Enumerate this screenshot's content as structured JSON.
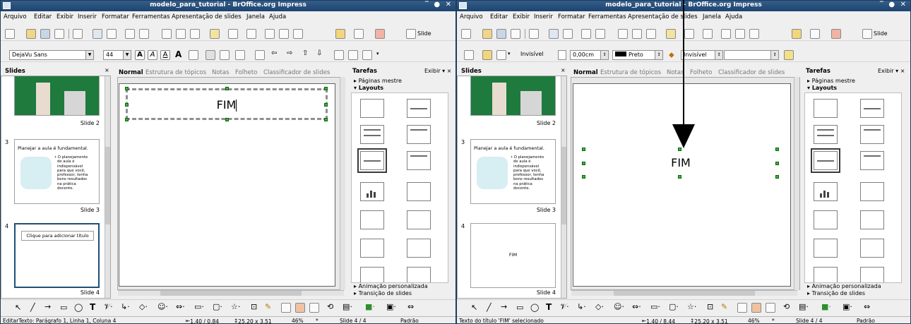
{
  "windows": [
    {
      "title": "modelo_para_tutorial - BrOffice.org Impress",
      "menus": [
        "Arquivo",
        "Editar",
        "Exibir",
        "Inserir",
        "Formatar",
        "Ferramentas",
        "Apresentação de slides",
        "Janela",
        "Ajuda"
      ],
      "slide_button": "Slide",
      "font_name": "DejaVu Sans",
      "font_size": "44",
      "slides_title": "Slides",
      "slides": [
        {
          "num": "",
          "label": "Slide 2"
        },
        {
          "num": "3",
          "label": "Slide 3",
          "text": "Planejar a aula é fundamental.",
          "bullets": [
            "• O planejamento",
            "de aula é",
            "indispensável",
            "para que você,",
            "professor, tenha",
            "bons resultados",
            "na prática",
            "docente."
          ]
        },
        {
          "num": "4",
          "label": "Slide 4",
          "placeholder": "Clique para adicionar título"
        }
      ],
      "tabs": [
        "Normal",
        "Estrutura de tópicos",
        "Notas",
        "Folheto",
        "Classificador de slides"
      ],
      "slide_text": "FIM",
      "tasks_title": "Tarefas",
      "exibir": "Exibir",
      "task_sections": [
        "Páginas mestre",
        "Layouts",
        "Animação personalizada",
        "Transição de slides"
      ],
      "status": {
        "left": "EditarTexto: Parágrafo 1, Linha 1, Coluna 4",
        "pos": "1,40 / 0,84",
        "size": "25,20 x 3,51",
        "zoom": "46%",
        "mod": "*",
        "slide": "Slide 4 / 4",
        "layout": "Padrão"
      }
    },
    {
      "title": "modelo_para_tutorial - BrOffice.org Impress",
      "menus": [
        "Arquivo",
        "Editar",
        "Exibir",
        "Inserir",
        "Formatar",
        "Ferramentas",
        "Apresentação de slides",
        "Janela",
        "Ajuda"
      ],
      "slide_button": "Slide",
      "line_style": "Invisível",
      "line_width": "0,00cm",
      "line_color": "Preto",
      "area_style": "Invisível",
      "slides_title": "Slides",
      "slides": [
        {
          "num": "",
          "label": "Slide 2"
        },
        {
          "num": "3",
          "label": "Slide 3",
          "text": "Planejar a aula é fundamental.",
          "bullets": [
            "• O planejamento",
            "de aula é",
            "indispensável",
            "para que você,",
            "professor, tenha",
            "bons resultados",
            "na prática",
            "docente."
          ]
        },
        {
          "num": "4",
          "label": "Slide 4",
          "thumb_text": "FIM"
        }
      ],
      "tabs": [
        "Normal",
        "Estrutura de tópicos",
        "Notas",
        "Folheto",
        "Classificador de slides"
      ],
      "slide_text": "FIM",
      "tasks_title": "Tarefas",
      "exibir": "Exibir",
      "task_sections": [
        "Páginas mestre",
        "Layouts",
        "Animação personalizada",
        "Transição de slides"
      ],
      "status": {
        "left": "Texto do título 'FIM' selecionado",
        "pos": "1,40 / 8,44",
        "size": "25,20 x 3,51",
        "zoom": "46%",
        "mod": "*",
        "slide": "Slide 4 / 4",
        "layout": "Padrão"
      }
    }
  ],
  "colors": {
    "titlebar": "#1d4470",
    "selection": "#1f4f78",
    "handle": "#3cb43c"
  }
}
